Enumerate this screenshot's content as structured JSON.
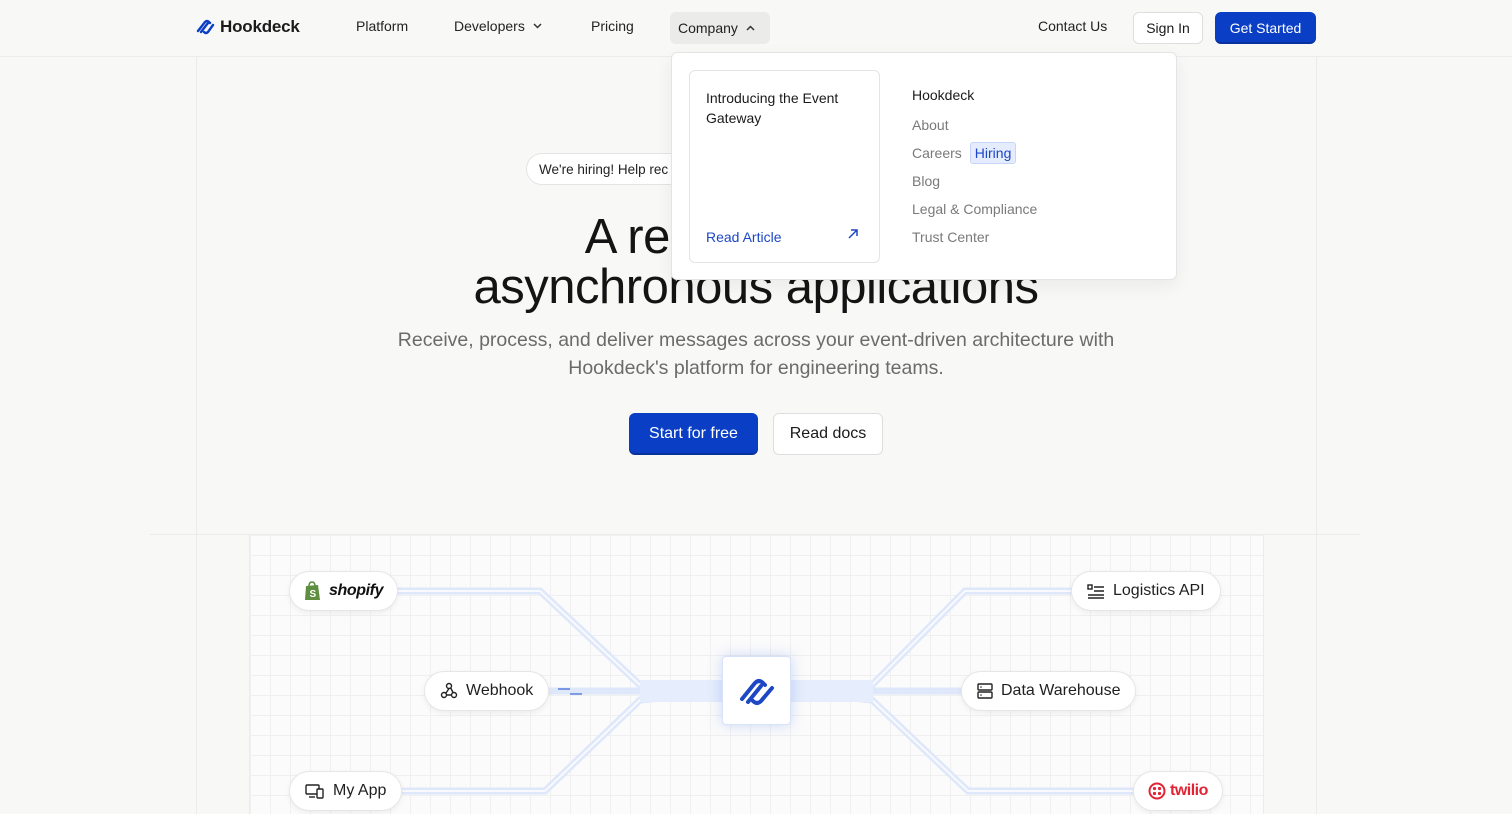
{
  "nav": {
    "logo_text": "Hookdeck",
    "links": [
      "Platform",
      "Developers",
      "Pricing",
      "Company"
    ],
    "contact": "Contact Us",
    "sign_in": "Sign In",
    "get_started": "Get Started"
  },
  "dropdown": {
    "card_title": "Introducing the Event Gateway",
    "card_link": "Read Article",
    "section_title": "Hookdeck",
    "items": [
      "About",
      "Careers",
      "Blog",
      "Legal & Compliance",
      "Trust Center"
    ],
    "careers_badge": "Hiring"
  },
  "hero": {
    "hiring_pill": "We're hiring! Help rec",
    "title_line1": "A reliable",
    "title_line2": "asynchronous applications",
    "subtitle": "Receive, process, and deliver messages across your event-driven architecture with Hookdeck's platform for engineering teams.",
    "cta_primary": "Start for free",
    "cta_secondary": "Read docs"
  },
  "diagram": {
    "sources": [
      "shopify",
      "Webhook",
      "My App"
    ],
    "destinations": [
      "Logistics API",
      "Data Warehouse",
      "twilio"
    ]
  },
  "colors": {
    "brand_blue": "#0a3ec4",
    "link_blue": "#1d47c4"
  }
}
